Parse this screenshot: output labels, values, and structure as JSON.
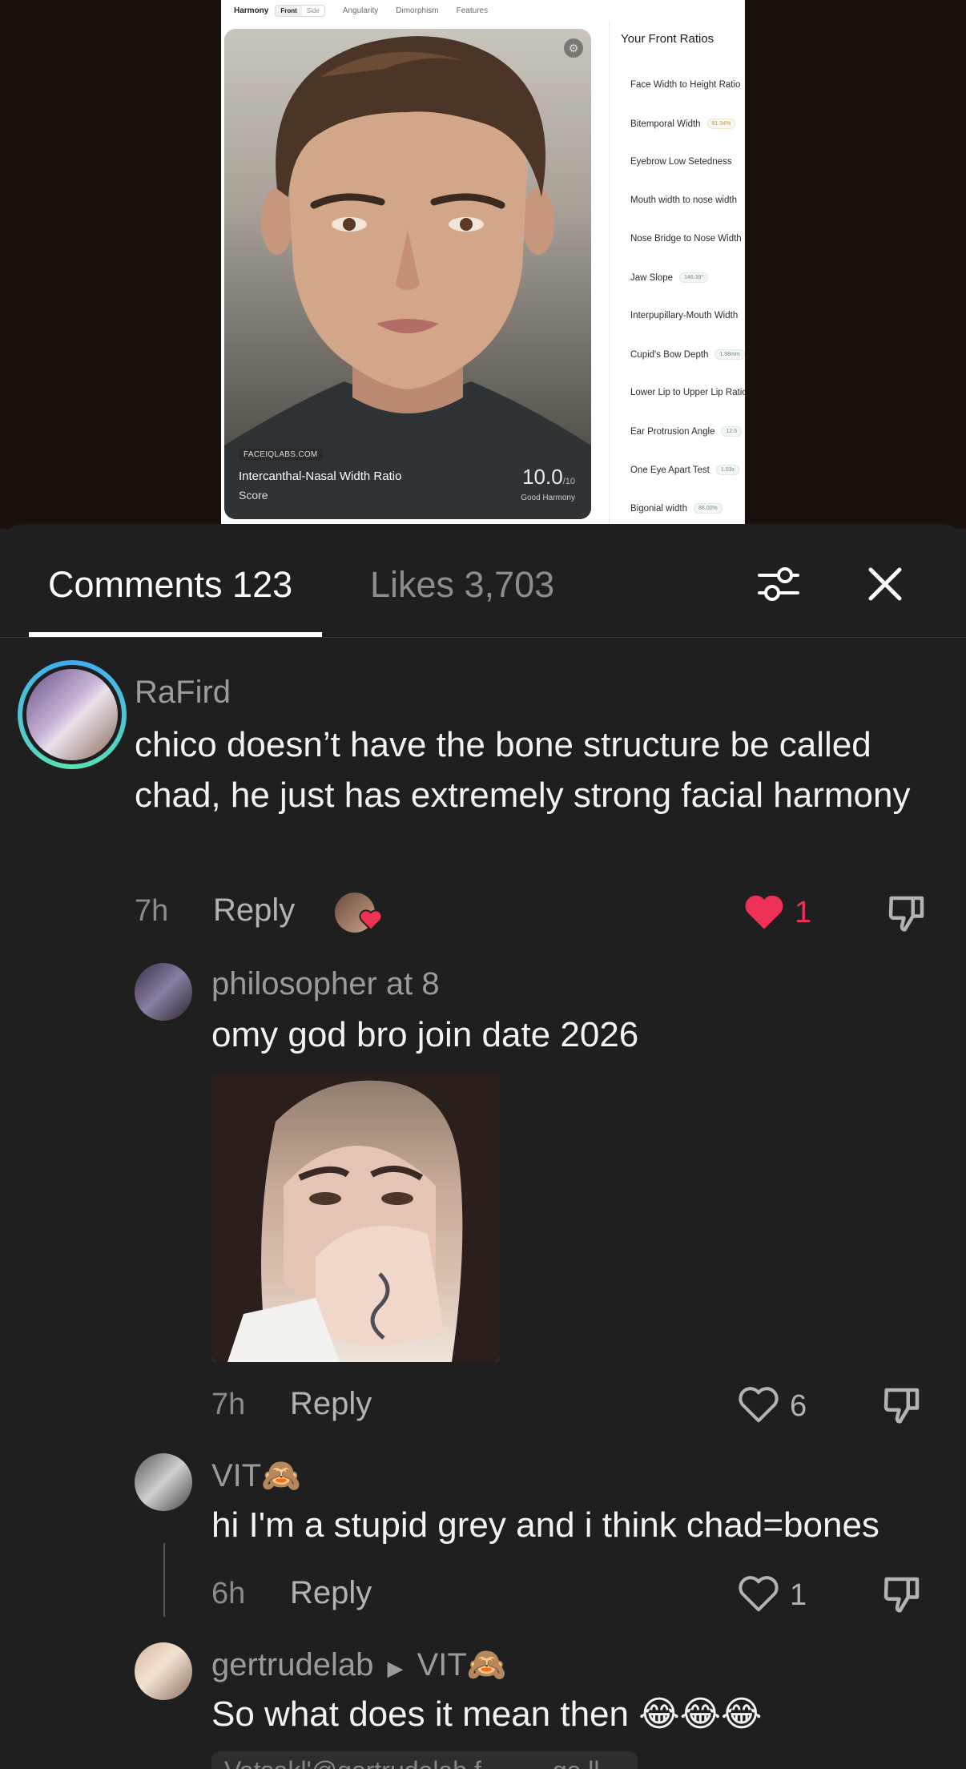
{
  "video": {
    "tabs": {
      "harmony": "Harmony",
      "front": "Front",
      "side": "Side",
      "angularity": "Angularity",
      "dimorphism": "Dimorphism",
      "features": "Features"
    },
    "face_card": {
      "site": "FACEIQLABS.COM",
      "metric": "Intercanthal-Nasal Width Ratio",
      "score_label": "Score",
      "score": "10.0",
      "score_max": "/10",
      "harmony": "Good Harmony",
      "settings_icon": "gear-icon"
    },
    "ratios_title": "Your Front Ratios",
    "ratios": [
      {
        "label": "Face Width to Height Ratio",
        "pill": ""
      },
      {
        "label": "Bitemporal Width",
        "pill": "81.34%"
      },
      {
        "label": "Eyebrow Low Setedness",
        "pill": ""
      },
      {
        "label": "Mouth width to nose width",
        "pill": ""
      },
      {
        "label": "Nose Bridge to Nose Width",
        "pill": ""
      },
      {
        "label": "Jaw Slope",
        "pill": "146.39°"
      },
      {
        "label": "Interpupillary-Mouth Width",
        "pill": ""
      },
      {
        "label": "Cupid's Bow Depth",
        "pill": "1.98mm"
      },
      {
        "label": "Lower Lip to Upper Lip Ratio",
        "pill": ""
      },
      {
        "label": "Ear Protrusion Angle",
        "pill": "12.5"
      },
      {
        "label": "One Eye Apart Test",
        "pill": "1.03x"
      },
      {
        "label": "Bigonial width",
        "pill": "86.00%"
      }
    ]
  },
  "sheet": {
    "comments_tab": "Comments 123",
    "likes_tab": "Likes 3,703",
    "filter_icon": "sliders-icon",
    "close_icon": "close-icon"
  },
  "comments": [
    {
      "username": "RaFird",
      "text": "chico doesn’t have the bone structure be called chad, he just has extremely strong facial harmony",
      "time": "7h",
      "reply": "Reply",
      "likes": "1",
      "liked": true
    },
    {
      "username": "philosopher at 8",
      "text": "omy god bro join date 2026",
      "time": "7h",
      "reply": "Reply",
      "likes": "6",
      "liked": false
    },
    {
      "username": "VIT",
      "username_emoji": "🙈",
      "text": "hi I'm a stupid grey and i think chad=bones",
      "time": "6h",
      "reply": "Reply",
      "likes": "1",
      "liked": false
    },
    {
      "username": "gertrudelab",
      "reply_to": "VIT",
      "reply_to_emoji": "🙈",
      "text": "So what does it mean then 😂😂😂",
      "partial_bubble": "Vatsakl'@gertrudelab f_____ge ll"
    }
  ],
  "colors": {
    "like_red": "#ee3154",
    "sheet_bg": "#1f1f1f",
    "text_muted": "#9b9b9b"
  }
}
